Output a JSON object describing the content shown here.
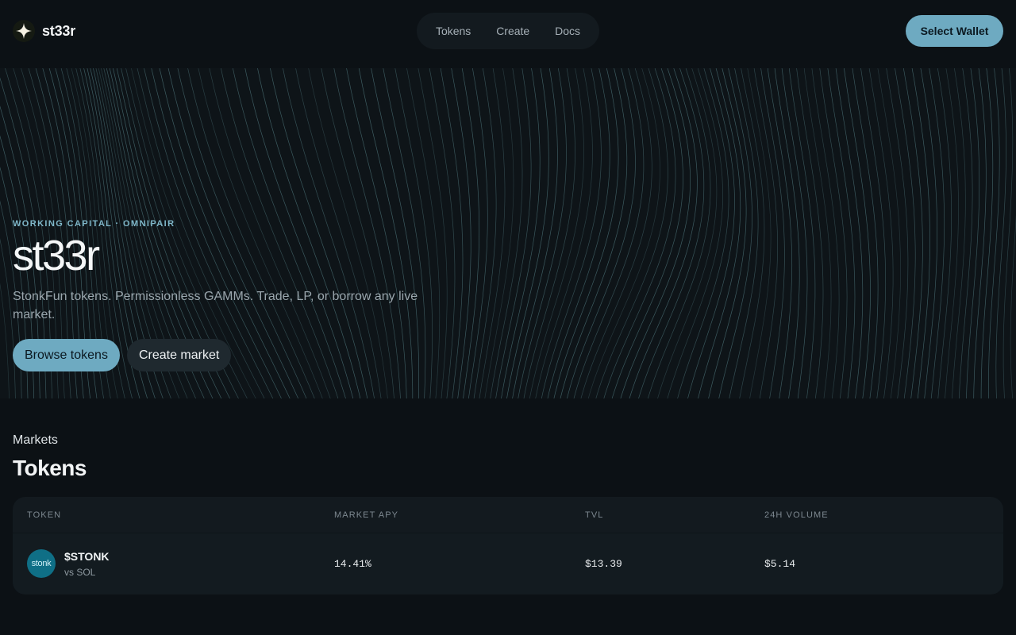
{
  "brand": {
    "name": "st33r",
    "logo_icon": "sparkle-icon"
  },
  "nav": {
    "items": [
      {
        "label": "Tokens"
      },
      {
        "label": "Create"
      },
      {
        "label": "Docs"
      }
    ]
  },
  "wallet": {
    "label": "Select Wallet"
  },
  "hero": {
    "eyebrow": "WORKING CAPITAL · OMNIPAIR",
    "title": "st33r",
    "subtitle": "StonkFun tokens. Permissionless GAMMs. Trade, LP, or borrow any live market.",
    "primary_cta": "Browse tokens",
    "secondary_cta": "Create market"
  },
  "markets": {
    "label": "Markets",
    "title": "Tokens",
    "columns": [
      "TOKEN",
      "MARKET APY",
      "TVL",
      "24H VOLUME"
    ],
    "rows": [
      {
        "avatar_text": "stonk",
        "name": "$STONK",
        "pair": "vs SOL",
        "apy": "14.41%",
        "tvl": "$13.39",
        "volume": "$5.14"
      }
    ]
  },
  "colors": {
    "background": "#0c1115",
    "accent": "#6eaac1",
    "hero_lines": "#5f8f95"
  }
}
